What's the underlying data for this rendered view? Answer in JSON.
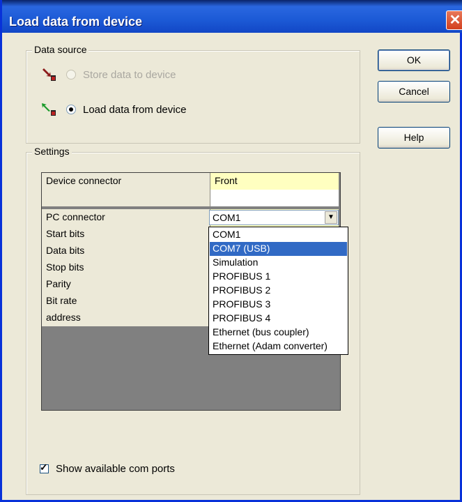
{
  "window": {
    "title": "Load data from device",
    "close_glyph": "✕"
  },
  "buttons": {
    "ok": "OK",
    "cancel": "Cancel",
    "help": "Help"
  },
  "data_source": {
    "legend": "Data source",
    "options": [
      {
        "label": "Store data to device",
        "checked": false,
        "enabled": false,
        "icon": "arrow-down-icon"
      },
      {
        "label": "Load data from device",
        "checked": true,
        "enabled": true,
        "icon": "arrow-up-icon"
      }
    ]
  },
  "settings": {
    "legend": "Settings",
    "rows": [
      {
        "name": "Device connector",
        "value": "Front"
      },
      {
        "name": "",
        "value": ""
      },
      {
        "name": "PC connector",
        "value": "COM1"
      },
      {
        "name": "Start bits",
        "value": ""
      },
      {
        "name": "Data bits",
        "value": ""
      },
      {
        "name": "Stop bits",
        "value": ""
      },
      {
        "name": "Parity",
        "value": ""
      },
      {
        "name": "Bit rate",
        "value": ""
      },
      {
        "name": "address",
        "value": ""
      }
    ],
    "pc_connector_options": [
      "COM1",
      "COM7 (USB)",
      "Simulation",
      "PROFIBUS 1",
      "PROFIBUS 2",
      "PROFIBUS 3",
      "PROFIBUS 4",
      "Ethernet (bus coupler)",
      "Ethernet (Adam converter)"
    ],
    "highlighted_option": "COM7 (USB)"
  },
  "show_ports": {
    "label": "Show available com ports",
    "checked": true
  },
  "colors": {
    "title_bar": "#1c5ad6",
    "highlight": "#316ac5",
    "cell_yellow": "#ffffc0",
    "grid_empty": "#808080"
  }
}
